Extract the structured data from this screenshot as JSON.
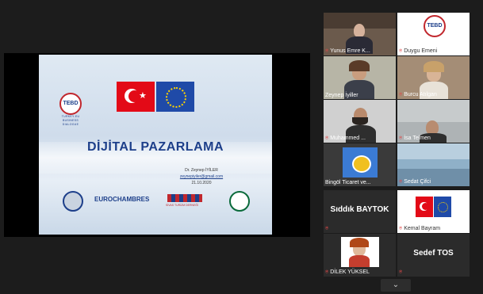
{
  "slide": {
    "tebd_logo": "TEBD",
    "tebd_sub": [
      "TURKEY-EU",
      "BUSINESS",
      "DIALOGUE"
    ],
    "title": "DİJİTAL PAZARLAMA",
    "presenter": "Dr. Zeynep İYİLER",
    "email": "zeynepiyiler@gmail.com",
    "date": "21.10.2020",
    "logo_eurochambres": "EUROCHAMBRES",
    "logo_tourism": "SİVAS TURİZM DERNEĞİ"
  },
  "participants": [
    {
      "name": "Yunus Emre K...",
      "type": "video",
      "bg": "#6b5a4c"
    },
    {
      "name": "Duygu Emeni",
      "type": "logo",
      "bg": "#ffffff"
    },
    {
      "name": "Zeynep İyiller",
      "type": "video",
      "bg": "#b7b5a6",
      "active": true
    },
    {
      "name": "Burcu Atılgan",
      "type": "video",
      "bg": "#a48d76"
    },
    {
      "name": "Muhammed ...",
      "type": "video",
      "bg": "#d0d0d0"
    },
    {
      "name": "İsa Telmen",
      "type": "video",
      "bg": "#aeb3b5"
    },
    {
      "name": "Bingöl Ticaret ve...",
      "type": "image",
      "bg": "#3a3a3a"
    },
    {
      "name": "Sedat Çifci",
      "type": "video",
      "bg": "#8fb0c8"
    },
    {
      "name": "Sıddık BAYTOK",
      "type": "name"
    },
    {
      "name": "Kemal Bayram",
      "type": "flags",
      "bg": "#ffffff"
    },
    {
      "name": "DİLEK YÜKSEL",
      "type": "video",
      "bg": "#ffffff"
    },
    {
      "name": "Sedef TOS",
      "type": "name"
    }
  ],
  "icons": {
    "mic": "mic-muted-icon",
    "chevron": "chevron-down-icon"
  }
}
